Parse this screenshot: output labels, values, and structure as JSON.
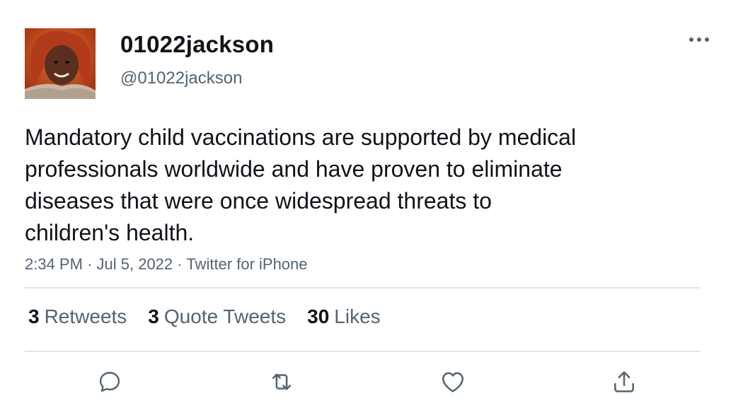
{
  "user": {
    "display_name": "01022jackson",
    "handle": "@01022jackson",
    "avatar_icon": "profile-photo"
  },
  "tweet": {
    "text": "Mandatory child vaccinations are supported by medical\nprofessionals worldwide and have proven to eliminate\ndiseases that were once widespread threats to\nchildren's health.",
    "time": "2:34 PM",
    "date": "Jul 5, 2022",
    "source": "Twitter for iPhone",
    "separator": "·"
  },
  "stats": {
    "retweets": {
      "count": "3",
      "label": "Retweets"
    },
    "quotes": {
      "count": "3",
      "label": "Quote Tweets"
    },
    "likes": {
      "count": "30",
      "label": "Likes"
    }
  },
  "actions": {
    "reply_icon": "reply-icon",
    "retweet_icon": "retweet-icon",
    "like_icon": "heart-icon",
    "share_icon": "share-icon",
    "more_icon": "more-horizontal-icon"
  },
  "colors": {
    "text": "#0f1419",
    "secondary": "#536471",
    "divider": "#e1e4e7",
    "icon": "#536471"
  }
}
